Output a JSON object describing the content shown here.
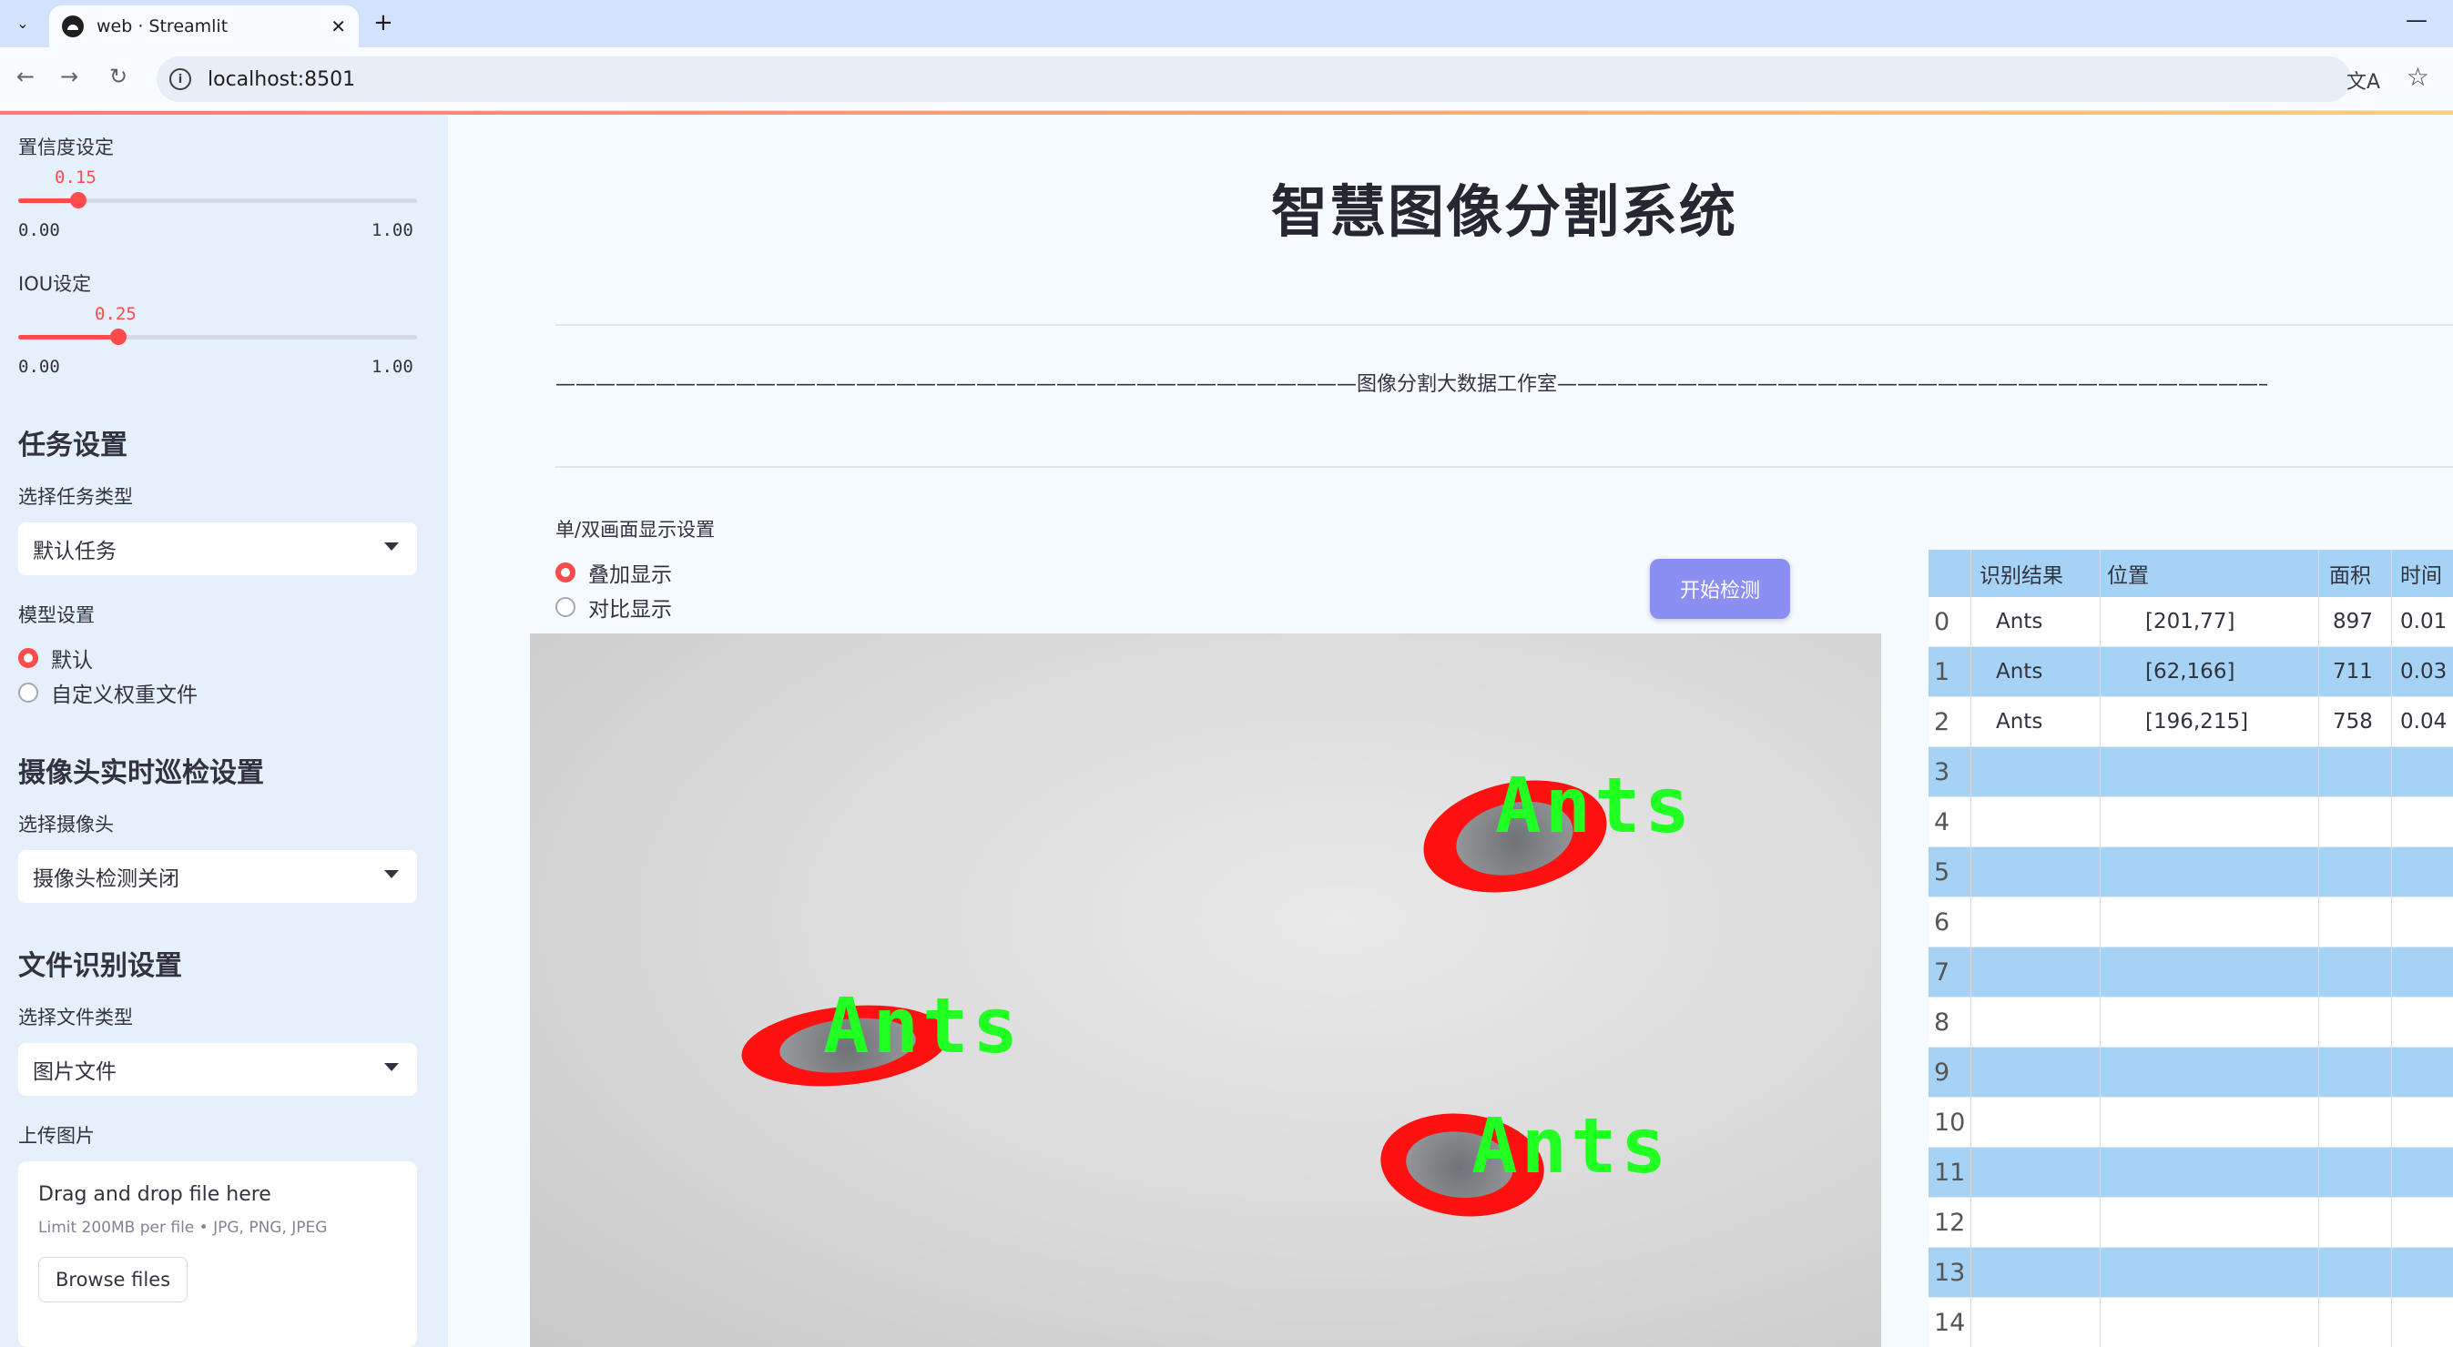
{
  "browser": {
    "tab_title": "web · Streamlit",
    "new_tab": "+",
    "url": "localhost:8501",
    "minimize": "—"
  },
  "sidebar": {
    "confidence": {
      "label": "置信度设定",
      "value": "0.15",
      "min": "0.00",
      "max": "1.00",
      "fraction": 0.15
    },
    "iou": {
      "label": "IOU设定",
      "value": "0.25",
      "min": "0.00",
      "max": "1.00",
      "fraction": 0.25
    },
    "task": {
      "heading": "任务设置",
      "label": "选择任务类型",
      "selected": "默认任务"
    },
    "model": {
      "label": "模型设置",
      "options": [
        "默认",
        "自定义权重文件"
      ],
      "selected_index": 0
    },
    "camera": {
      "heading": "摄像头实时巡检设置",
      "label": "选择摄像头",
      "selected": "摄像头检测关闭"
    },
    "file": {
      "heading": "文件识别设置",
      "label": "选择文件类型",
      "selected": "图片文件"
    },
    "upload": {
      "label": "上传图片",
      "title": "Drag and drop file here",
      "subtitle": "Limit 200MB per file • JPG, PNG, JPEG",
      "button": "Browse files"
    }
  },
  "main": {
    "title": "智慧图像分割系统",
    "subtitle": "————————————————————————————————————————图像分割大数据工作室———————————————————————————————————————————",
    "display_mode": {
      "label": "单/双画面显示设置",
      "options": [
        "叠加显示",
        "对比显示"
      ],
      "selected_index": 0
    },
    "start_button": "开始检测",
    "detections": [
      {
        "label": "Ants"
      },
      {
        "label": "Ants"
      },
      {
        "label": "Ants"
      }
    ]
  },
  "results_table": {
    "columns": [
      "",
      "识别结果",
      "位置",
      "面积",
      "时间"
    ],
    "rows": [
      {
        "index": "0",
        "result": "Ants",
        "position": "[201,77]",
        "area": "897",
        "time": "0.01"
      },
      {
        "index": "1",
        "result": "Ants",
        "position": "[62,166]",
        "area": "711",
        "time": "0.03"
      },
      {
        "index": "2",
        "result": "Ants",
        "position": "[196,215]",
        "area": "758",
        "time": "0.04"
      },
      {
        "index": "3",
        "result": "",
        "position": "",
        "area": "",
        "time": ""
      },
      {
        "index": "4",
        "result": "",
        "position": "",
        "area": "",
        "time": ""
      },
      {
        "index": "5",
        "result": "",
        "position": "",
        "area": "",
        "time": ""
      },
      {
        "index": "6",
        "result": "",
        "position": "",
        "area": "",
        "time": ""
      },
      {
        "index": "7",
        "result": "",
        "position": "",
        "area": "",
        "time": ""
      },
      {
        "index": "8",
        "result": "",
        "position": "",
        "area": "",
        "time": ""
      },
      {
        "index": "9",
        "result": "",
        "position": "",
        "area": "",
        "time": ""
      },
      {
        "index": "10",
        "result": "",
        "position": "",
        "area": "",
        "time": ""
      },
      {
        "index": "11",
        "result": "",
        "position": "",
        "area": "",
        "time": ""
      },
      {
        "index": "12",
        "result": "",
        "position": "",
        "area": "",
        "time": ""
      },
      {
        "index": "13",
        "result": "",
        "position": "",
        "area": "",
        "time": ""
      },
      {
        "index": "14",
        "result": "",
        "position": "",
        "area": "",
        "time": ""
      }
    ]
  },
  "colors": {
    "accent": "#ff4b4b",
    "table_stripe": "#a6d3f5",
    "button": "#8b8ff2",
    "sidebar_bg": "#e6f0fb",
    "mask": "#ff1111",
    "label_text": "#22ff22"
  }
}
